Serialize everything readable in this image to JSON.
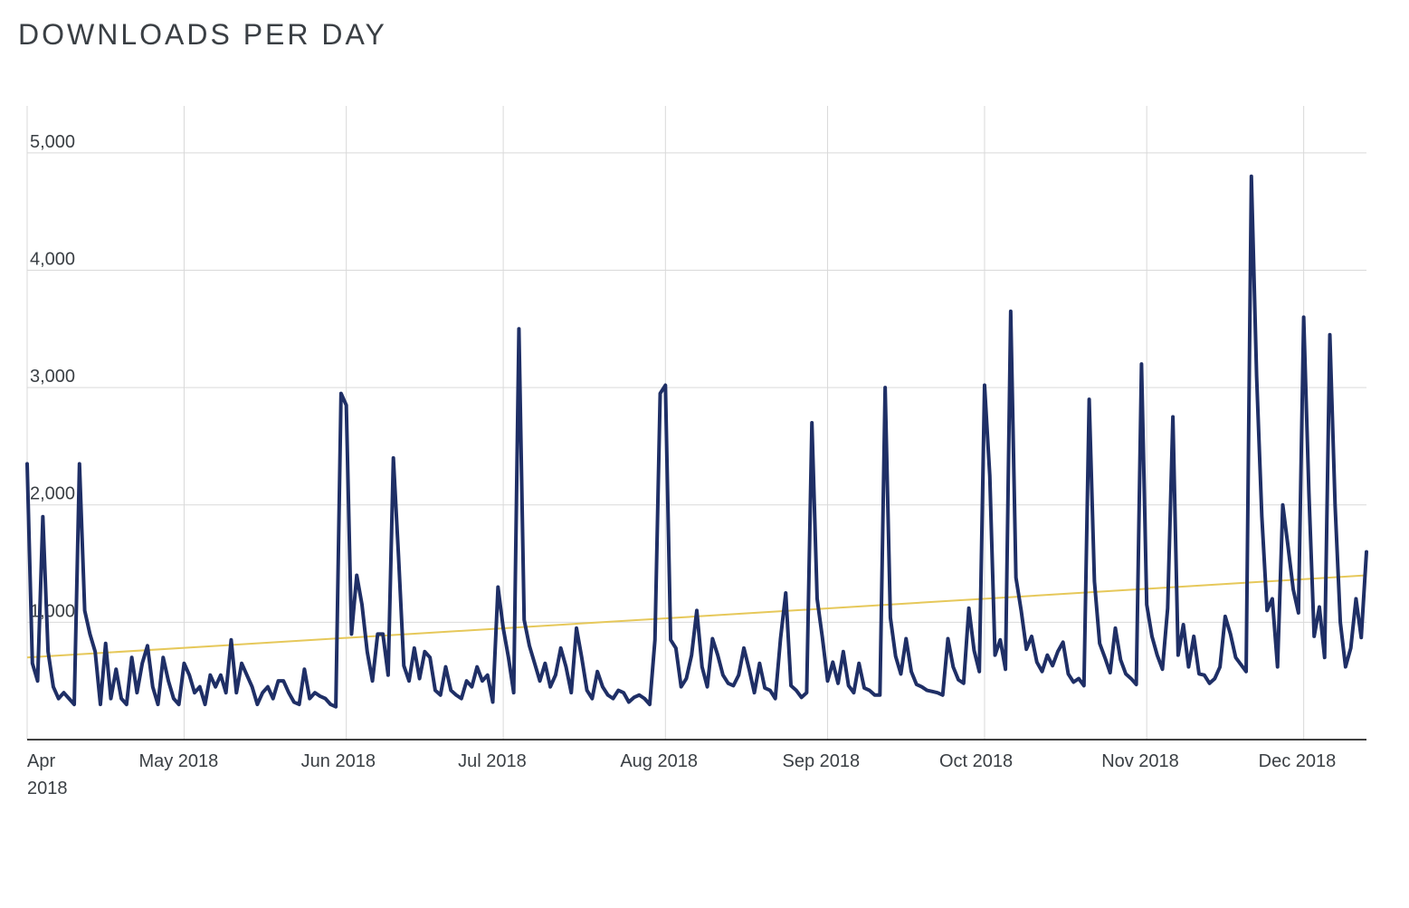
{
  "chart_data": {
    "type": "line",
    "title": "DOWNLOADS PER DAY",
    "xlabel": "",
    "ylabel": "",
    "ylim": [
      0,
      5400
    ],
    "y_ticks": [
      1000,
      2000,
      3000,
      4000,
      5000
    ],
    "y_tick_labels": [
      "1,000",
      "2,000",
      "3,000",
      "4,000",
      "5,000"
    ],
    "x_tick_indices": [
      0,
      30,
      61,
      91,
      122,
      153,
      183,
      214,
      244
    ],
    "x_tick_labels": [
      "Apr 2018",
      "May 2018",
      "Jun 2018",
      "Jul 2018",
      "Aug 2018",
      "Sep 2018",
      "Oct 2018",
      "Nov 2018",
      "Dec 2018"
    ],
    "trend": {
      "start": 700,
      "end": 1400
    },
    "series": [
      {
        "name": "downloads",
        "color": "#1f2f66",
        "values": [
          2350,
          650,
          500,
          1900,
          750,
          450,
          350,
          400,
          350,
          300,
          2350,
          1100,
          900,
          750,
          300,
          820,
          350,
          600,
          350,
          300,
          700,
          400,
          650,
          800,
          450,
          300,
          700,
          500,
          350,
          300,
          650,
          550,
          400,
          450,
          300,
          550,
          450,
          550,
          400,
          850,
          400,
          650,
          550,
          450,
          300,
          400,
          450,
          350,
          500,
          500,
          400,
          320,
          300,
          600,
          350,
          400,
          370,
          350,
          300,
          280,
          2950,
          2850,
          900,
          1400,
          1150,
          750,
          500,
          900,
          900,
          550,
          2400,
          1550,
          630,
          500,
          780,
          520,
          750,
          700,
          420,
          380,
          620,
          420,
          380,
          350,
          500,
          450,
          620,
          500,
          550,
          320,
          1300,
          950,
          700,
          400,
          3500,
          1020,
          800,
          650,
          500,
          650,
          450,
          550,
          780,
          620,
          400,
          950,
          700,
          420,
          350,
          580,
          450,
          380,
          350,
          420,
          400,
          320,
          360,
          380,
          350,
          300,
          850,
          2950,
          3020,
          850,
          780,
          450,
          520,
          720,
          1100,
          620,
          450,
          860,
          720,
          550,
          480,
          460,
          550,
          780,
          600,
          400,
          650,
          440,
          420,
          350,
          860,
          1250,
          460,
          420,
          360,
          400,
          2700,
          1200,
          870,
          500,
          660,
          480,
          750,
          460,
          400,
          650,
          440,
          420,
          380,
          380,
          3000,
          1040,
          710,
          560,
          860,
          580,
          470,
          450,
          420,
          410,
          400,
          380,
          860,
          620,
          510,
          480,
          1120,
          760,
          580,
          3020,
          2250,
          720,
          850,
          600,
          3650,
          1380,
          1100,
          770,
          880,
          660,
          580,
          720,
          630,
          750,
          830,
          560,
          490,
          520,
          460,
          2900,
          1350,
          820,
          700,
          570,
          950,
          680,
          560,
          520,
          470,
          3200,
          1150,
          880,
          720,
          600,
          1120,
          2750,
          720,
          980,
          620,
          880,
          560,
          550,
          480,
          520,
          620,
          1050,
          900,
          700,
          640,
          580,
          4800,
          3100,
          1900,
          1100,
          1200,
          620,
          2000,
          1650,
          1280,
          1080,
          3600,
          2100,
          880,
          1130,
          700,
          3450,
          2000,
          1000,
          620,
          780,
          1200,
          870,
          1600
        ]
      }
    ]
  }
}
